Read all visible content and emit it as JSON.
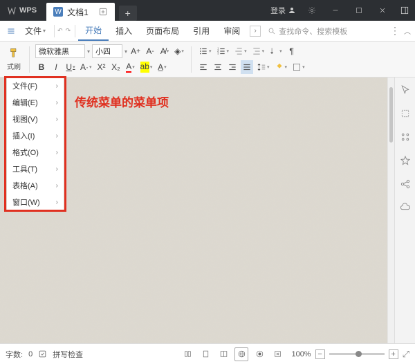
{
  "titlebar": {
    "app": "WPS",
    "login": "登录"
  },
  "doctab": {
    "icon": "W",
    "title": "文档1"
  },
  "menubar": {
    "file": "文件",
    "tabs": [
      "开始",
      "插入",
      "页面布局",
      "引用",
      "审阅"
    ],
    "active_tab": 0,
    "search_placeholder": "查找命令、搜索模板"
  },
  "toolbar": {
    "fmtbrush": "式刷",
    "font_name": "微软雅黑",
    "font_size": "小四"
  },
  "dropdown": {
    "items": [
      "文件(F)",
      "编辑(E)",
      "视图(V)",
      "插入(I)",
      "格式(O)",
      "工具(T)",
      "表格(A)",
      "窗口(W)"
    ]
  },
  "annotation": "传统菜单的菜单项",
  "statusbar": {
    "wordcount_label": "字数:",
    "wordcount": "0",
    "spellcheck": "拼写检查",
    "zoom": "100%"
  }
}
